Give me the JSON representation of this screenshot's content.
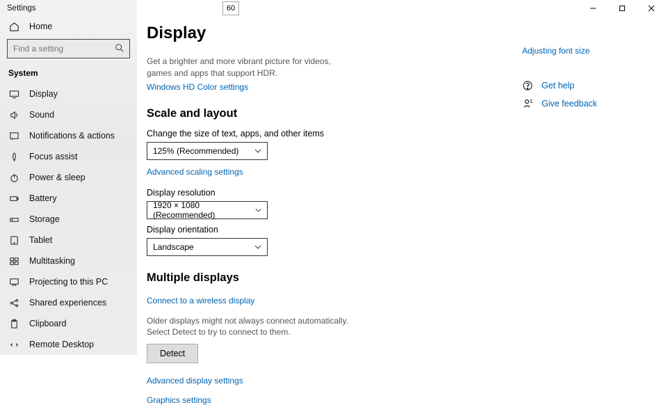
{
  "window": {
    "title": "Settings",
    "badge": "60"
  },
  "sidebar": {
    "home": "Home",
    "search_placeholder": "Find a setting",
    "section": "System",
    "items": [
      {
        "label": "Display"
      },
      {
        "label": "Sound"
      },
      {
        "label": "Notifications & actions"
      },
      {
        "label": "Focus assist"
      },
      {
        "label": "Power & sleep"
      },
      {
        "label": "Battery"
      },
      {
        "label": "Storage"
      },
      {
        "label": "Tablet"
      },
      {
        "label": "Multitasking"
      },
      {
        "label": "Projecting to this PC"
      },
      {
        "label": "Shared experiences"
      },
      {
        "label": "Clipboard"
      },
      {
        "label": "Remote Desktop"
      }
    ]
  },
  "main": {
    "title": "Display",
    "hdr_text": "Get a brighter and more vibrant picture for videos, games and apps that support HDR.",
    "hdr_link": "Windows HD Color settings",
    "scale_heading": "Scale and layout",
    "scale_label": "Change the size of text, apps, and other items",
    "scale_value": "125% (Recommended)",
    "adv_scale_link": "Advanced scaling settings",
    "res_label": "Display resolution",
    "res_value": "1920 × 1080 (Recommended)",
    "orient_label": "Display orientation",
    "orient_value": "Landscape",
    "multi_heading": "Multiple displays",
    "wireless_link": "Connect to a wireless display",
    "detect_text": "Older displays might not always connect automatically. Select Detect to try to connect to them.",
    "detect_btn": "Detect",
    "adv_display_link": "Advanced display settings",
    "graphics_link": "Graphics settings"
  },
  "aside": {
    "adjust_link": "Adjusting font size",
    "get_help": "Get help",
    "give_feedback": "Give feedback"
  }
}
